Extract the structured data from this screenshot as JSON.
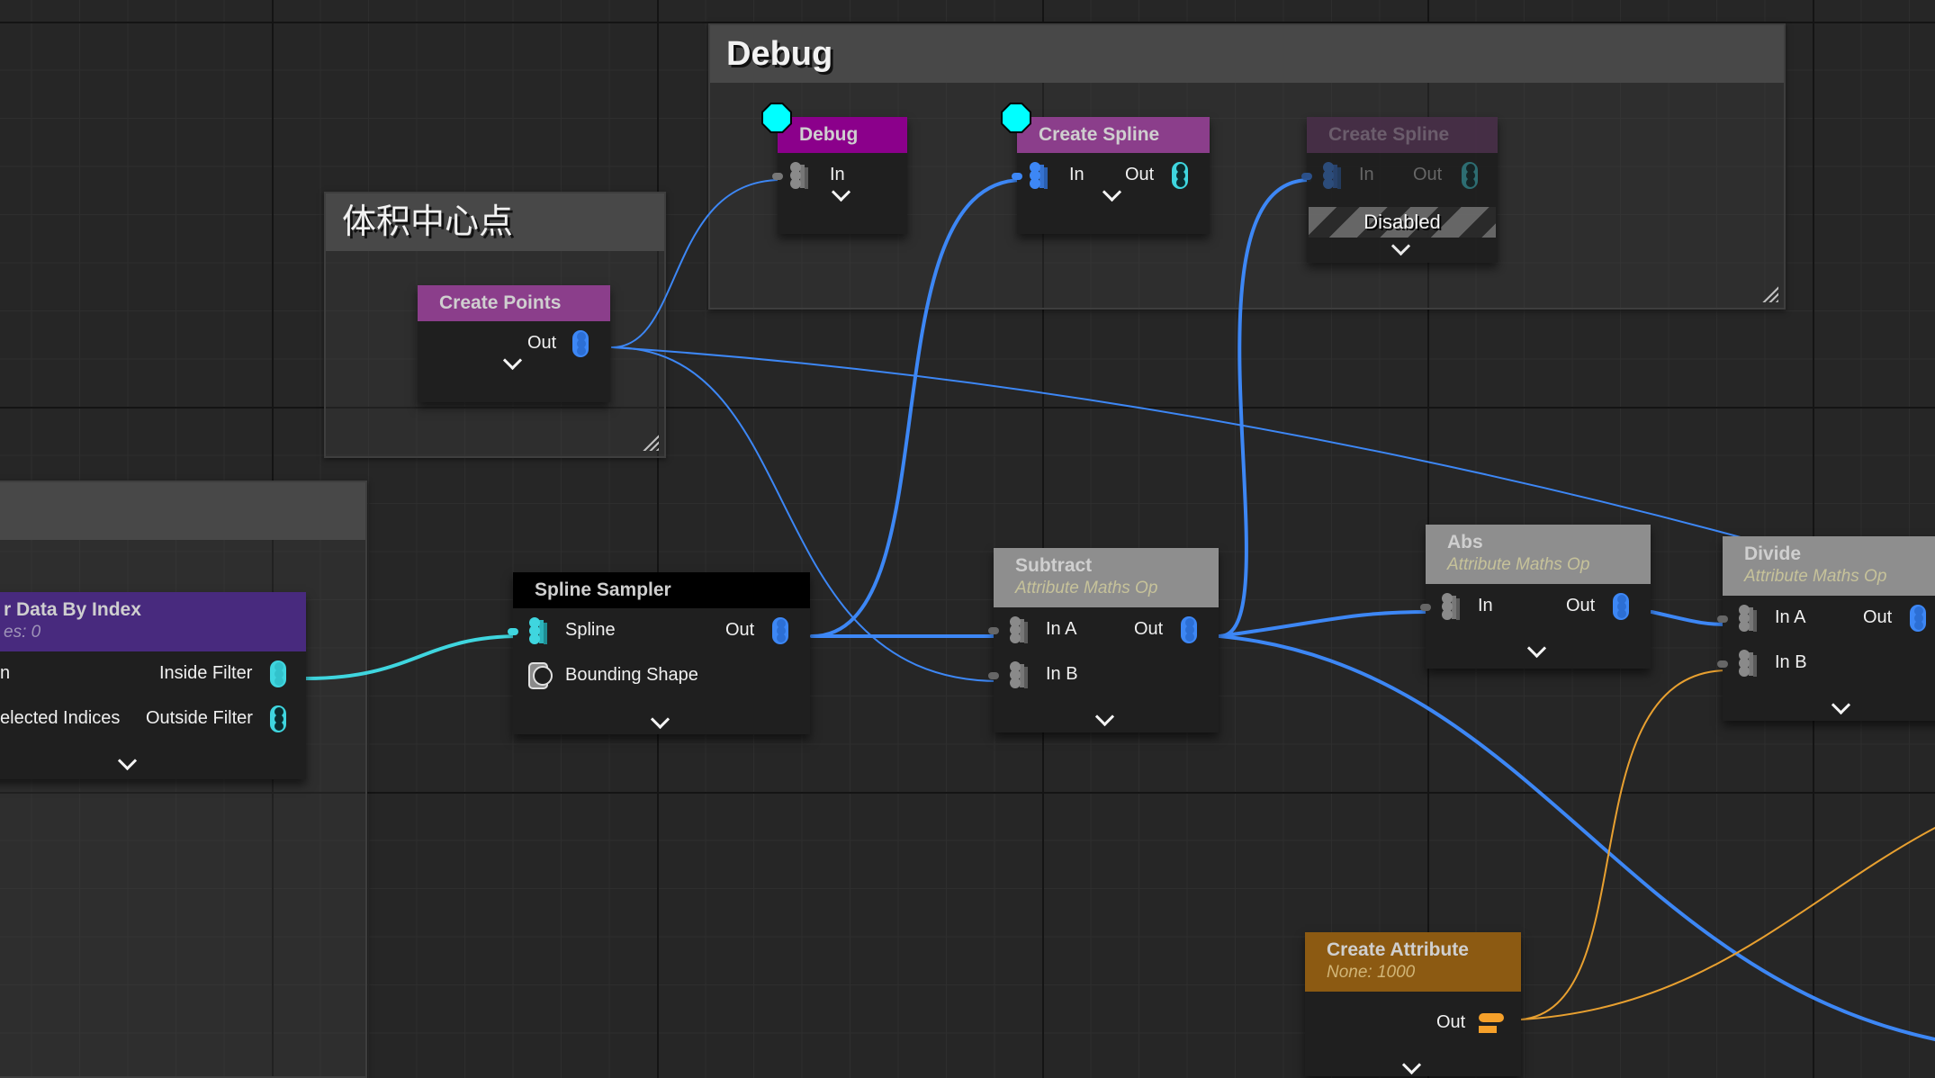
{
  "graph": {
    "comments": [
      {
        "id": "debug",
        "title": "Debug"
      },
      {
        "id": "volume-center",
        "title": "体积中心点"
      },
      {
        "id": "left-group",
        "title": ""
      }
    ],
    "nodes": {
      "debug": {
        "title": "Debug",
        "header_color": "#8b008b",
        "pins": {
          "in": "In"
        }
      },
      "create_spline_1": {
        "title": "Create Spline",
        "header_color": "#8b3e8b",
        "pins": {
          "in": "In",
          "out": "Out"
        }
      },
      "create_spline_2": {
        "title": "Create Spline",
        "header_color": "#472f47",
        "pins": {
          "in": "In",
          "out": "Out"
        },
        "state": "Disabled"
      },
      "create_points": {
        "title": "Create Points",
        "header_color": "#8b3e8b",
        "pins": {
          "out": "Out"
        }
      },
      "filter_data_by_index": {
        "title": "Filter Data By Index",
        "visible_title": "r Data By Index",
        "subtitle": "es: 0",
        "header_color": "#482a7e",
        "pins": {
          "in": "n",
          "selected": "elected Indices",
          "inside": "Inside Filter",
          "outside": "Outside Filter"
        }
      },
      "spline_sampler": {
        "title": "Spline Sampler",
        "header_color": "#000000",
        "pins": {
          "spline": "Spline",
          "bounding": "Bounding Shape",
          "out": "Out"
        }
      },
      "subtract": {
        "title": "Subtract",
        "subtitle": "Attribute Maths Op",
        "header_color": "#8e8e8e",
        "pins": {
          "in_a": "In A",
          "in_b": "In B",
          "out": "Out"
        }
      },
      "abs": {
        "title": "Abs",
        "subtitle": "Attribute Maths Op",
        "header_color": "#8e8e8e",
        "pins": {
          "in": "In",
          "out": "Out"
        }
      },
      "divide": {
        "title": "Divide",
        "subtitle": "Attribute Maths Op",
        "header_color": "#8e8e8e",
        "pins": {
          "in_a": "In A",
          "in_b": "In B",
          "out": "Out"
        }
      },
      "create_attribute": {
        "title": "Create Attribute",
        "subtitle": "None: 1000",
        "header_color": "#8c5a12",
        "pins": {
          "out": "Out"
        }
      }
    },
    "colors": {
      "point_wire": "#3d87f5",
      "spline_wire": "#3fd6df",
      "attribute_wire": "#e8a030",
      "exec_debug_marker": "#00ffff"
    }
  }
}
